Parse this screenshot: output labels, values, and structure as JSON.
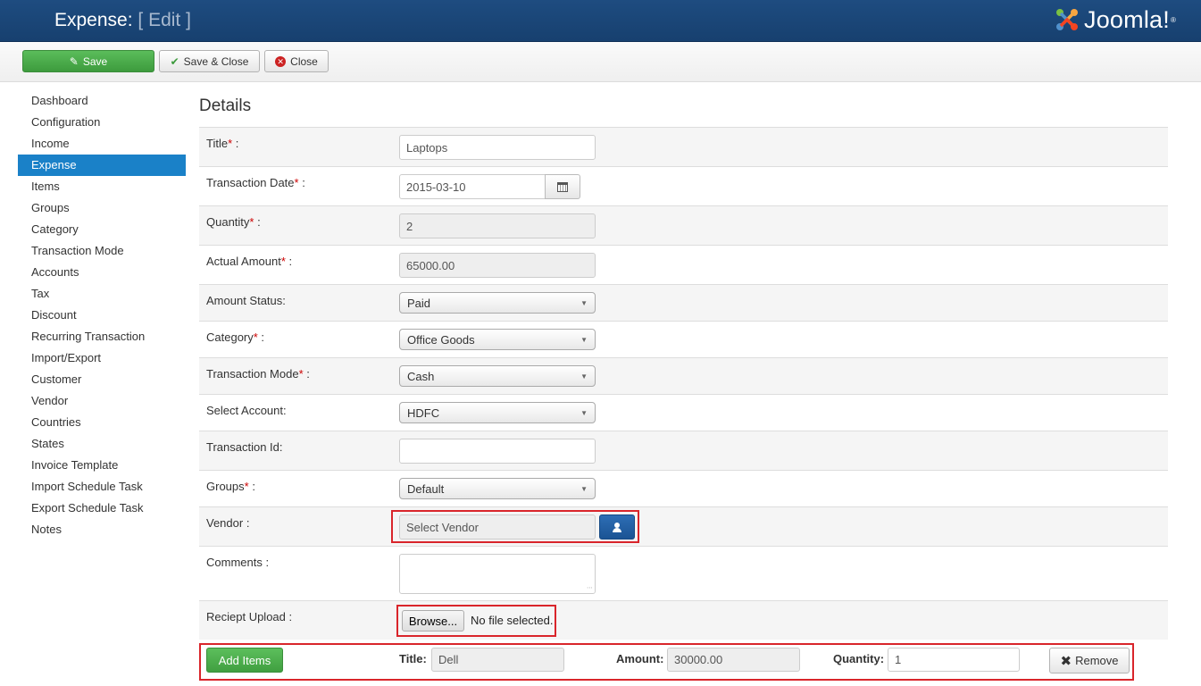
{
  "header": {
    "title": "Expense:",
    "title_suffix": "[ Edit ]",
    "logo_text": "Joomla!",
    "logo_reg": "®"
  },
  "toolbar": {
    "save_label": "Save",
    "save_close_label": "Save & Close",
    "close_label": "Close"
  },
  "sidebar": {
    "items": [
      {
        "label": "Dashboard"
      },
      {
        "label": "Configuration"
      },
      {
        "label": "Income"
      },
      {
        "label": "Expense",
        "active": true
      },
      {
        "label": "Items"
      },
      {
        "label": "Groups"
      },
      {
        "label": "Category"
      },
      {
        "label": "Transaction Mode"
      },
      {
        "label": "Accounts"
      },
      {
        "label": "Tax"
      },
      {
        "label": "Discount"
      },
      {
        "label": "Recurring Transaction"
      },
      {
        "label": "Import/Export"
      },
      {
        "label": "Customer"
      },
      {
        "label": "Vendor"
      },
      {
        "label": "Countries"
      },
      {
        "label": "States"
      },
      {
        "label": "Invoice Template"
      },
      {
        "label": "Import Schedule Task"
      },
      {
        "label": "Export Schedule Task"
      },
      {
        "label": "Notes"
      }
    ]
  },
  "main": {
    "section_title": "Details",
    "required_mark": "*",
    "colon": " :",
    "fields": {
      "title": {
        "label": "Title",
        "value": "Laptops"
      },
      "transaction_date": {
        "label": "Transaction Date",
        "value": "2015-03-10"
      },
      "quantity": {
        "label": "Quantity",
        "value": "2"
      },
      "actual_amount": {
        "label": "Actual Amount",
        "value": "65000.00"
      },
      "amount_status": {
        "label": "Amount Status:",
        "value": "Paid"
      },
      "category": {
        "label": "Category",
        "value": "Office Goods"
      },
      "transaction_mode": {
        "label": "Transaction Mode",
        "value": "Cash"
      },
      "select_account": {
        "label": "Select Account:",
        "value": "HDFC"
      },
      "transaction_id": {
        "label": "Transaction Id:",
        "value": ""
      },
      "groups": {
        "label": "Groups",
        "value": "Default"
      },
      "vendor": {
        "label": "Vendor :",
        "placeholder": "Select Vendor"
      },
      "comments": {
        "label": "Comments :",
        "value": ""
      },
      "receipt_upload": {
        "label": "Reciept Upload :",
        "browse_label": "Browse...",
        "status": "No file selected."
      }
    },
    "items_row": {
      "add_label": "Add Items",
      "title_label": "Title:",
      "title_value": "Dell",
      "amount_label": "Amount:",
      "amount_value": "30000.00",
      "quantity_label": "Quantity:",
      "quantity_value": "1",
      "remove_label": "Remove"
    }
  },
  "colors": {
    "header_bg": "#1e4c80",
    "active_nav": "#1a81c8",
    "save_green": "#46a546",
    "required_red": "#cc0000",
    "highlight_box": "#d9252b",
    "vendor_button": "#2d6eb5"
  },
  "icons": {
    "save": "edit-square-icon",
    "save_close": "check-icon",
    "close": "close-circle-icon",
    "date": "calendar-icon",
    "vendor": "user-icon",
    "remove": "x-icon",
    "logo": "joomla-logo-icon"
  }
}
